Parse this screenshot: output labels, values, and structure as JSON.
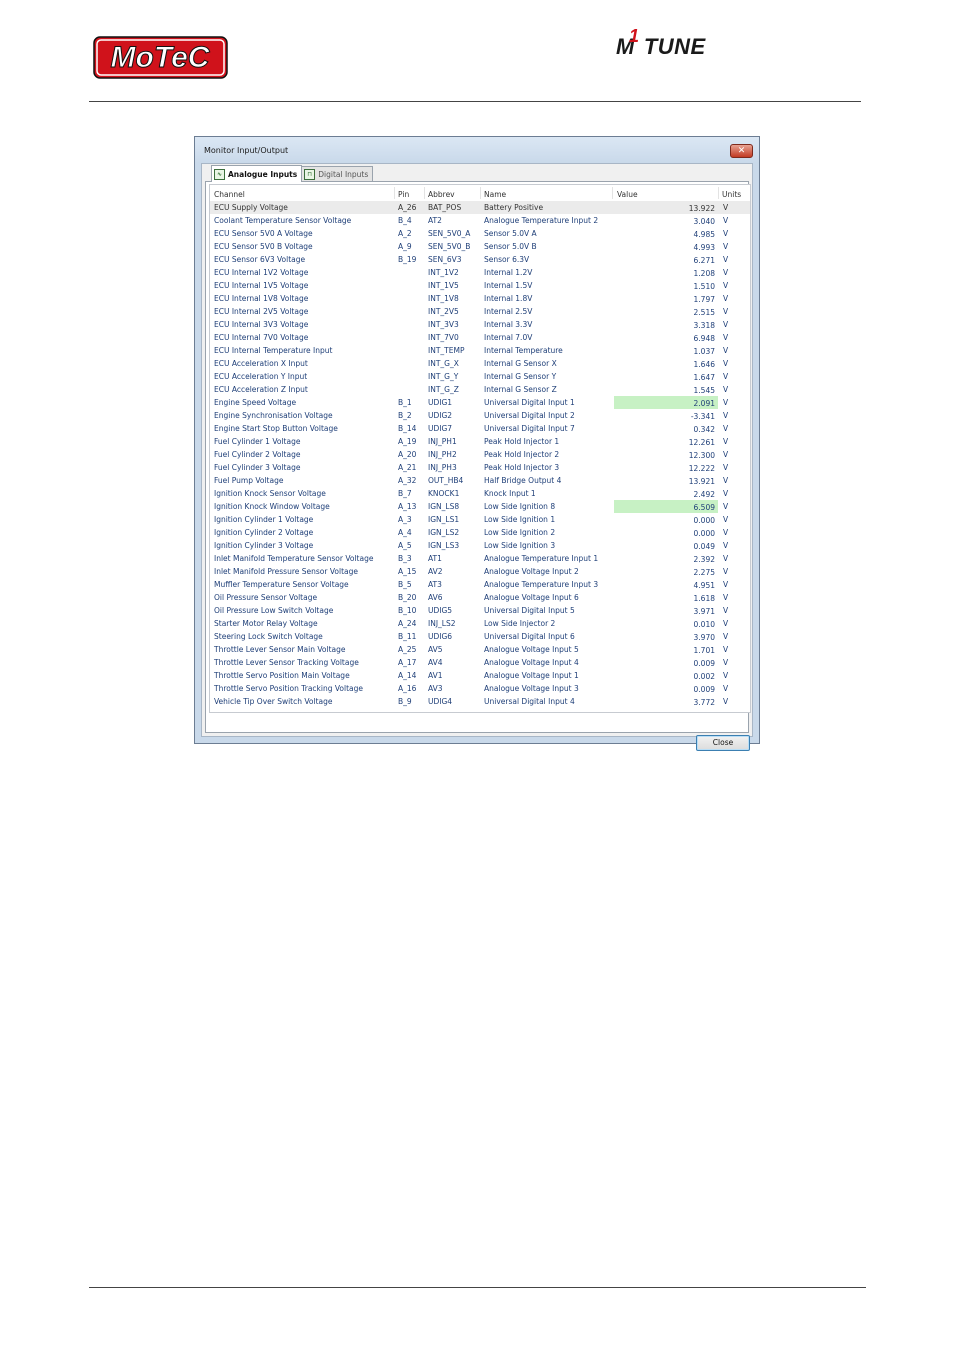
{
  "header": {
    "logo_motec": "MoTeC",
    "logo_m1": "M",
    "logo_one": "1",
    "logo_tune": "TUNE"
  },
  "window": {
    "title": "Monitor Input/Output",
    "close_glyph": "✕",
    "tabs": [
      {
        "label": "Analogue Inputs",
        "active": true
      },
      {
        "label": "Digital Inputs",
        "active": false
      }
    ],
    "columns": {
      "channel": "Channel",
      "pin": "Pin",
      "abbrev": "Abbrev",
      "name": "Name",
      "value": "Value",
      "units": "Units"
    },
    "highlight_color": "#c7f1c4",
    "rows": [
      {
        "channel": "ECU Supply Voltage",
        "pin": "A_26",
        "abbrev": "BAT_POS",
        "name": "Battery Positive",
        "value": "13.922",
        "units": "V"
      },
      {
        "channel": "Coolant Temperature Sensor Voltage",
        "pin": "B_4",
        "abbrev": "AT2",
        "name": "Analogue Temperature Input 2",
        "value": "3.040",
        "units": "V"
      },
      {
        "channel": "ECU Sensor 5V0 A Voltage",
        "pin": "A_2",
        "abbrev": "SEN_5V0_A",
        "name": "Sensor 5.0V A",
        "value": "4.985",
        "units": "V"
      },
      {
        "channel": "ECU Sensor 5V0 B Voltage",
        "pin": "A_9",
        "abbrev": "SEN_5V0_B",
        "name": "Sensor 5.0V B",
        "value": "4.993",
        "units": "V"
      },
      {
        "channel": "ECU Sensor 6V3 Voltage",
        "pin": "B_19",
        "abbrev": "SEN_6V3",
        "name": "Sensor 6.3V",
        "value": "6.271",
        "units": "V"
      },
      {
        "channel": "ECU Internal 1V2 Voltage",
        "pin": "",
        "abbrev": "INT_1V2",
        "name": "Internal 1.2V",
        "value": "1.208",
        "units": "V"
      },
      {
        "channel": "ECU Internal 1V5 Voltage",
        "pin": "",
        "abbrev": "INT_1V5",
        "name": "Internal 1.5V",
        "value": "1.510",
        "units": "V"
      },
      {
        "channel": "ECU Internal 1V8 Voltage",
        "pin": "",
        "abbrev": "INT_1V8",
        "name": "Internal 1.8V",
        "value": "1.797",
        "units": "V"
      },
      {
        "channel": "ECU Internal 2V5 Voltage",
        "pin": "",
        "abbrev": "INT_2V5",
        "name": "Internal 2.5V",
        "value": "2.515",
        "units": "V"
      },
      {
        "channel": "ECU Internal 3V3 Voltage",
        "pin": "",
        "abbrev": "INT_3V3",
        "name": "Internal 3.3V",
        "value": "3.318",
        "units": "V"
      },
      {
        "channel": "ECU Internal 7V0 Voltage",
        "pin": "",
        "abbrev": "INT_7V0",
        "name": "Internal 7.0V",
        "value": "6.948",
        "units": "V"
      },
      {
        "channel": "ECU Internal Temperature Input",
        "pin": "",
        "abbrev": "INT_TEMP",
        "name": "Internal Temperature",
        "value": "1.037",
        "units": "V"
      },
      {
        "channel": "ECU Acceleration X Input",
        "pin": "",
        "abbrev": "INT_G_X",
        "name": "Internal G Sensor X",
        "value": "1.646",
        "units": "V"
      },
      {
        "channel": "ECU Acceleration Y Input",
        "pin": "",
        "abbrev": "INT_G_Y",
        "name": "Internal G Sensor Y",
        "value": "1.647",
        "units": "V"
      },
      {
        "channel": "ECU Acceleration Z Input",
        "pin": "",
        "abbrev": "INT_G_Z",
        "name": "Internal G Sensor Z",
        "value": "1.545",
        "units": "V"
      },
      {
        "channel": "Engine Speed Voltage",
        "pin": "B_1",
        "abbrev": "UDIG1",
        "name": "Universal Digital Input 1",
        "value": "2.091",
        "units": "V",
        "highlight": true
      },
      {
        "channel": "Engine Synchronisation Voltage",
        "pin": "B_2",
        "abbrev": "UDIG2",
        "name": "Universal Digital Input 2",
        "value": "-3.341",
        "units": "V"
      },
      {
        "channel": "Engine Start Stop Button Voltage",
        "pin": "B_14",
        "abbrev": "UDIG7",
        "name": "Universal Digital Input 7",
        "value": "0.342",
        "units": "V"
      },
      {
        "channel": "Fuel Cylinder 1 Voltage",
        "pin": "A_19",
        "abbrev": "INJ_PH1",
        "name": "Peak Hold Injector 1",
        "value": "12.261",
        "units": "V"
      },
      {
        "channel": "Fuel Cylinder 2 Voltage",
        "pin": "A_20",
        "abbrev": "INJ_PH2",
        "name": "Peak Hold Injector 2",
        "value": "12.300",
        "units": "V"
      },
      {
        "channel": "Fuel Cylinder 3 Voltage",
        "pin": "A_21",
        "abbrev": "INJ_PH3",
        "name": "Peak Hold Injector 3",
        "value": "12.222",
        "units": "V"
      },
      {
        "channel": "Fuel Pump Voltage",
        "pin": "A_32",
        "abbrev": "OUT_HB4",
        "name": "Half Bridge Output 4",
        "value": "13.921",
        "units": "V"
      },
      {
        "channel": "Ignition Knock Sensor Voltage",
        "pin": "B_7",
        "abbrev": "KNOCK1",
        "name": "Knock Input 1",
        "value": "2.492",
        "units": "V"
      },
      {
        "channel": "Ignition Knock Window Voltage",
        "pin": "A_13",
        "abbrev": "IGN_LS8",
        "name": "Low Side Ignition 8",
        "value": "6.509",
        "units": "V",
        "highlight": true
      },
      {
        "channel": "Ignition Cylinder 1 Voltage",
        "pin": "A_3",
        "abbrev": "IGN_LS1",
        "name": "Low Side Ignition 1",
        "value": "0.000",
        "units": "V"
      },
      {
        "channel": "Ignition Cylinder 2 Voltage",
        "pin": "A_4",
        "abbrev": "IGN_LS2",
        "name": "Low Side Ignition 2",
        "value": "0.000",
        "units": "V"
      },
      {
        "channel": "Ignition Cylinder 3 Voltage",
        "pin": "A_5",
        "abbrev": "IGN_LS3",
        "name": "Low Side Ignition 3",
        "value": "0.049",
        "units": "V"
      },
      {
        "channel": "Inlet Manifold Temperature Sensor Voltage",
        "pin": "B_3",
        "abbrev": "AT1",
        "name": "Analogue Temperature Input 1",
        "value": "2.392",
        "units": "V"
      },
      {
        "channel": "Inlet Manifold Pressure Sensor Voltage",
        "pin": "A_15",
        "abbrev": "AV2",
        "name": "Analogue Voltage Input 2",
        "value": "2.275",
        "units": "V"
      },
      {
        "channel": "Muffler Temperature Sensor Voltage",
        "pin": "B_5",
        "abbrev": "AT3",
        "name": "Analogue Temperature Input 3",
        "value": "4.951",
        "units": "V"
      },
      {
        "channel": "Oil Pressure Sensor Voltage",
        "pin": "B_20",
        "abbrev": "AV6",
        "name": "Analogue Voltage Input 6",
        "value": "1.618",
        "units": "V"
      },
      {
        "channel": "Oil Pressure Low Switch Voltage",
        "pin": "B_10",
        "abbrev": "UDIG5",
        "name": "Universal Digital Input 5",
        "value": "3.971",
        "units": "V"
      },
      {
        "channel": "Starter Motor Relay Voltage",
        "pin": "A_24",
        "abbrev": "INJ_LS2",
        "name": "Low Side Injector 2",
        "value": "0.010",
        "units": "V"
      },
      {
        "channel": "Steering Lock Switch Voltage",
        "pin": "B_11",
        "abbrev": "UDIG6",
        "name": "Universal Digital Input 6",
        "value": "3.970",
        "units": "V"
      },
      {
        "channel": "Throttle Lever Sensor Main Voltage",
        "pin": "A_25",
        "abbrev": "AV5",
        "name": "Analogue Voltage Input 5",
        "value": "1.701",
        "units": "V"
      },
      {
        "channel": "Throttle Lever Sensor Tracking Voltage",
        "pin": "A_17",
        "abbrev": "AV4",
        "name": "Analogue Voltage Input 4",
        "value": "0.009",
        "units": "V"
      },
      {
        "channel": "Throttle Servo Position Main Voltage",
        "pin": "A_14",
        "abbrev": "AV1",
        "name": "Analogue Voltage Input 1",
        "value": "0.002",
        "units": "V"
      },
      {
        "channel": "Throttle Servo Position Tracking Voltage",
        "pin": "A_16",
        "abbrev": "AV3",
        "name": "Analogue Voltage Input 3",
        "value": "0.009",
        "units": "V"
      },
      {
        "channel": "Vehicle Tip Over Switch Voltage",
        "pin": "B_9",
        "abbrev": "UDIG4",
        "name": "Universal Digital Input 4",
        "value": "3.772",
        "units": "V"
      }
    ],
    "close_button": "Close"
  }
}
